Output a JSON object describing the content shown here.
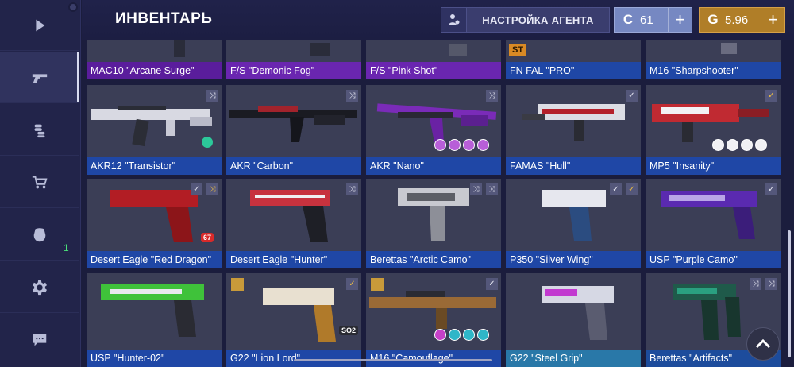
{
  "header": {
    "title": "ИНВЕНТАРЬ",
    "agent_button": "НАСТРОЙКА АГЕНТА",
    "silver": {
      "symbol": "C",
      "value": "61",
      "plus": "+"
    },
    "gold": {
      "symbol": "G",
      "value": "5.96",
      "plus": "+"
    }
  },
  "sidebar": {
    "items": [
      {
        "icon": "play-icon"
      },
      {
        "icon": "pistol-icon",
        "active": true
      },
      {
        "icon": "coins-icon"
      },
      {
        "icon": "cart-icon"
      },
      {
        "icon": "clan-icon",
        "badge": "1"
      },
      {
        "icon": "gear-icon"
      },
      {
        "icon": "chat-icon"
      }
    ]
  },
  "colors": {
    "background": "#1b1d3d",
    "rarity_blue": "#1f47a6",
    "rarity_purple": "#6a26b0",
    "silver": "#7688c2",
    "gold": "#b07e28"
  },
  "inventory": {
    "row1": [
      {
        "name": "MAC10 \"Arcane Surge\""
      },
      {
        "name": "F/S \"Demonic Fog\""
      },
      {
        "name": "F/S \"Pink Shot\""
      },
      {
        "name": "FN FAL \"PRO\"",
        "tag": "ST"
      },
      {
        "name": "M16 \"Sharpshooter\""
      }
    ],
    "row2": [
      {
        "name": "AKR12 \"Transistor\""
      },
      {
        "name": "AKR \"Carbon\""
      },
      {
        "name": "AKR \"Nano\""
      },
      {
        "name": "FAMAS \"Hull\""
      },
      {
        "name": "MP5 \"Insanity\""
      }
    ],
    "row3": [
      {
        "name": "Desert Eagle \"Red Dragon\"",
        "sticker_text": "67"
      },
      {
        "name": "Desert Eagle \"Hunter\""
      },
      {
        "name": "Berettas \"Arctic Camo\""
      },
      {
        "name": "P350 \"Silver Wing\""
      },
      {
        "name": "USP \"Purple Camo\""
      }
    ],
    "row4": [
      {
        "name": "USP \"Hunter-02\""
      },
      {
        "name": "G22 \"Lion Lord\"",
        "sticker_text": "SO2"
      },
      {
        "name": "M16 \"Camouflage\""
      },
      {
        "name": "G22 \"Steel Grip\""
      },
      {
        "name": "Berettas \"Artifacts\""
      }
    ]
  }
}
